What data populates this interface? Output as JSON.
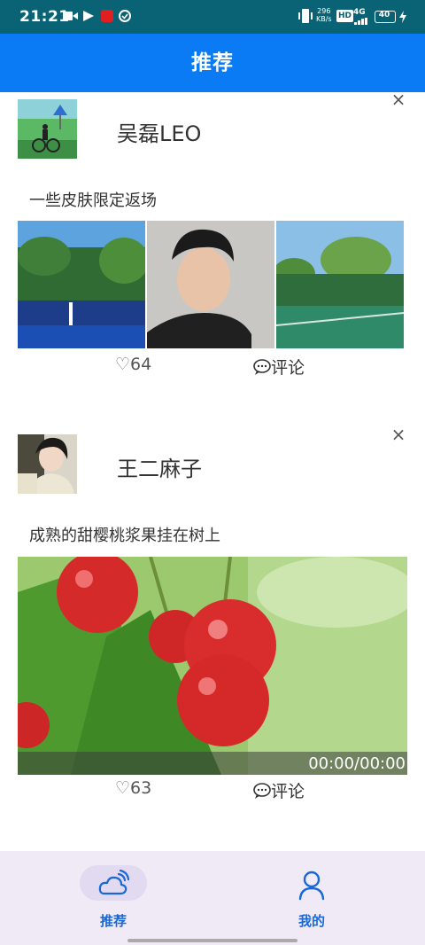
{
  "status_bar": {
    "time": "21:21",
    "net_speed_top": "296",
    "net_speed_unit": "KB/s",
    "hd": "HD",
    "network": "4G",
    "battery": "40"
  },
  "app_bar": {
    "title": "推荐"
  },
  "posts": [
    {
      "author": "吴磊LEO",
      "content": "一些皮肤限定返场",
      "likes": "64",
      "comment_label": "评论",
      "close": "×"
    },
    {
      "author": "王二麻子",
      "content": "成熟的甜樱桃浆果挂在树上",
      "likes": "63",
      "comment_label": "评论",
      "close": "×",
      "video_time": "00:00/00:00"
    }
  ],
  "icons": {
    "like": "heart-outline-icon",
    "comment": "speech-bubble-icon",
    "close": "close-icon",
    "home": "weather-cloud-icon",
    "profile": "person-icon"
  },
  "bottom_nav": {
    "items": [
      {
        "label": "推荐",
        "active": true
      },
      {
        "label": "我的",
        "active": false
      }
    ]
  },
  "colors": {
    "status_bar": "#0a6374",
    "app_bar": "#0a7bf5",
    "nav_active": "#1a68d8",
    "nav_bg": "#efeaf5"
  }
}
